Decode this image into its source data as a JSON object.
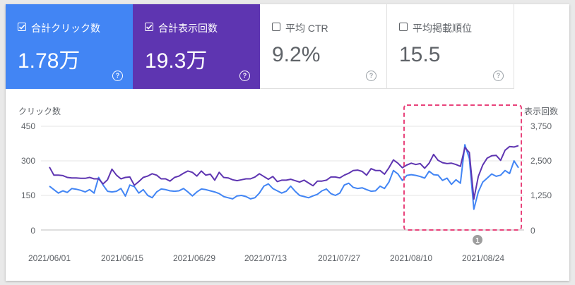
{
  "tiles": [
    {
      "label": "合計クリック数",
      "value": "1.78万",
      "checked": true,
      "color": "#4285f4"
    },
    {
      "label": "合計表示回数",
      "value": "19.3万",
      "checked": true,
      "color": "#5e35b1"
    },
    {
      "label": "平均 CTR",
      "value": "9.2%",
      "checked": false
    },
    {
      "label": "平均掲載順位",
      "value": "15.5",
      "checked": false
    }
  ],
  "help_glyph": "?",
  "annotation": {
    "label": "1"
  },
  "chart_data": {
    "type": "line",
    "y_left_label": "クリック数",
    "y_right_label": "表示回数",
    "y_left_ticks": [
      "450",
      "300",
      "150",
      "0"
    ],
    "y_right_ticks": [
      "3,750",
      "2,500",
      "1,250",
      "0"
    ],
    "ylim_left": [
      0,
      450
    ],
    "ylim_right": [
      0,
      3750
    ],
    "x_tick_labels": [
      "2021/06/01",
      "2021/06/15",
      "2021/06/29",
      "2021/07/13",
      "2021/07/27",
      "2021/08/10",
      "2021/08/24"
    ],
    "grid": true,
    "series": [
      {
        "name": "合計クリック数",
        "color": "#4285f4",
        "values": [
          190,
          175,
          160,
          170,
          163,
          180,
          177,
          172,
          165,
          175,
          160,
          228,
          195,
          168,
          165,
          168,
          180,
          147,
          195,
          188,
          160,
          175,
          150,
          140,
          165,
          178,
          175,
          170,
          168,
          170,
          180,
          165,
          148,
          165,
          178,
          175,
          170,
          165,
          158,
          145,
          140,
          135,
          148,
          150,
          145,
          135,
          140,
          160,
          190,
          200,
          180,
          170,
          160,
          168,
          190,
          168,
          150,
          145,
          140,
          148,
          155,
          170,
          178,
          158,
          150,
          160,
          195,
          203,
          185,
          180,
          183,
          175,
          168,
          170,
          190,
          180,
          208,
          258,
          243,
          215,
          237,
          240,
          237,
          232,
          225,
          255,
          240,
          238,
          215,
          225,
          198,
          218,
          203,
          370,
          310,
          90,
          165,
          208,
          225,
          243,
          233,
          238,
          258,
          245,
          300,
          270
        ]
      },
      {
        "name": "合計表示回数",
        "color": "#5e35b1",
        "values": [
          2275,
          1983,
          1983,
          1967,
          1900,
          1883,
          1883,
          1867,
          1867,
          1900,
          1850,
          1850,
          1667,
          1817,
          2200,
          1983,
          1850,
          1900,
          1917,
          1617,
          1750,
          1900,
          1950,
          2033,
          1983,
          1850,
          1850,
          1767,
          1900,
          1950,
          2050,
          2133,
          2083,
          1950,
          2133,
          1983,
          2017,
          1800,
          2083,
          1900,
          1883,
          1817,
          1783,
          1817,
          1850,
          1850,
          1917,
          2033,
          1933,
          1833,
          1933,
          1750,
          1800,
          1800,
          1833,
          1783,
          1733,
          1800,
          1700,
          1600,
          1767,
          1767,
          1800,
          1917,
          1917,
          1883,
          1983,
          2050,
          2150,
          2167,
          2117,
          1983,
          2217,
          2150,
          2150,
          2017,
          2250,
          2533,
          2417,
          2250,
          2350,
          2417,
          2367,
          2400,
          2233,
          2417,
          2733,
          2517,
          2433,
          2400,
          2417,
          2367,
          2300,
          2983,
          2800,
          1117,
          1933,
          2350,
          2600,
          2683,
          2700,
          2517,
          2883,
          3017,
          3000,
          3050
        ]
      }
    ]
  }
}
